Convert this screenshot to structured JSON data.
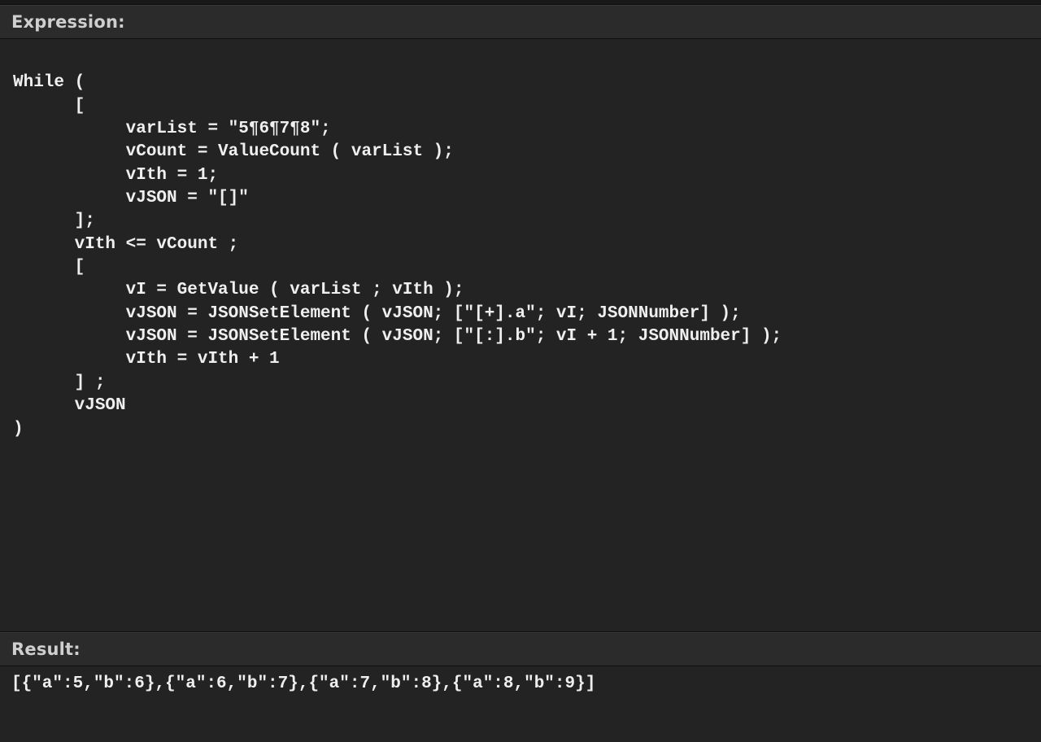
{
  "labels": {
    "expression": "Expression:",
    "result": "Result:"
  },
  "code": {
    "line1": "While (",
    "line2": "      [",
    "line3": "           varList = \"5¶6¶7¶8\";",
    "line4": "           vCount = ValueCount ( varList );",
    "line5": "           vIth = 1;",
    "line6": "           vJSON = \"[]\"",
    "line7": "      ];",
    "line8": "      vIth <= vCount ;",
    "line9": "      [",
    "line10": "           vI = GetValue ( varList ; vIth );",
    "line11": "           vJSON = JSONSetElement ( vJSON; [\"[+].a\"; vI; JSONNumber] );",
    "line12": "           vJSON = JSONSetElement ( vJSON; [\"[:].b\"; vI + 1; JSONNumber] );",
    "line13": "           vIth = vIth + 1",
    "line14": "      ] ;",
    "line15": "      vJSON",
    "line16": ")"
  },
  "result": "[{\"a\":5,\"b\":6},{\"a\":6,\"b\":7},{\"a\":7,\"b\":8},{\"a\":8,\"b\":9}]"
}
